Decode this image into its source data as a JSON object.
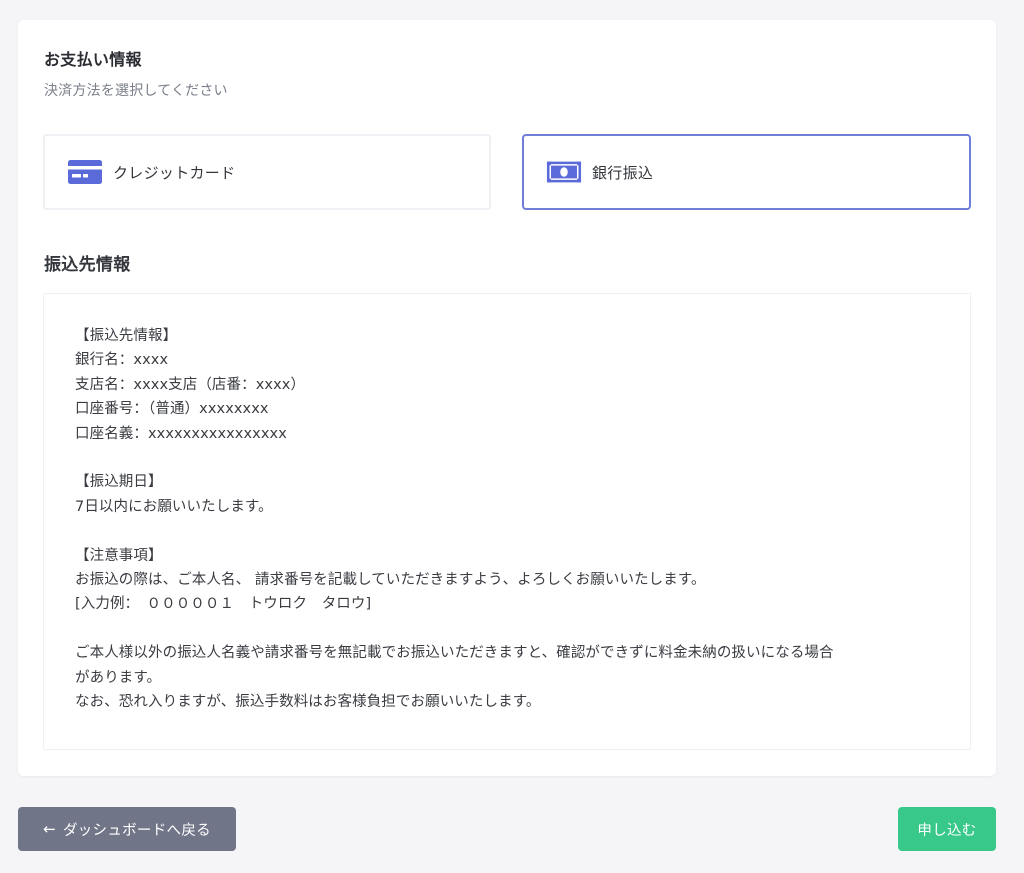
{
  "payment": {
    "title": "お支払い情報",
    "subtitle": "決済方法を選択してください",
    "methods": [
      {
        "label": "クレジットカード",
        "icon": "credit-card-icon",
        "selected": false
      },
      {
        "label": "銀行振込",
        "icon": "money-bill-icon",
        "selected": true
      }
    ]
  },
  "transfer": {
    "title": "振込先情報",
    "details": "【振込先情報】\n銀行名：xxxx\n支店名：xxxx支店（店番：xxxx）\n口座番号：（普通）xxxxxxxx\n口座名義：xxxxxxxxxxxxxxxx\n\n【振込期日】\n7日以内にお願いいたします。\n\n【注意事項】\nお振込の際は、ご本人名、 請求番号を記載していただきますよう、よろしくお願いいたします。\n[入力例：　０００００１　トウロク　タロウ]\n\nご本人様以外の振込人名義や請求番号を無記載でお振込いただきますと、確認ができずに料金未納の扱いになる場合\nがあります。\nなお、恐れ入りますが、振込手数料はお客様負担でお願いいたします。"
  },
  "footer": {
    "back_label": "ダッシュボードへ戻る",
    "back_icon": "arrow-left-icon",
    "apply_label": "申し込む"
  },
  "colors": {
    "accent": "#5a6ad8",
    "selected_border": "#6f7fd8",
    "back_button": "#717588",
    "apply_button": "#38c98a"
  }
}
